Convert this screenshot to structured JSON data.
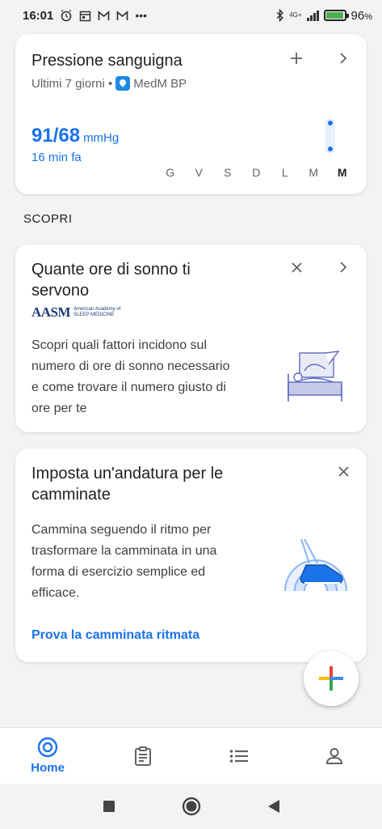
{
  "status_bar": {
    "time": "16:01",
    "left_icons": [
      "alarm-icon",
      "calendar-icon",
      "gmail-icon",
      "gmail-icon",
      "more-icon"
    ],
    "network_label": "4G+",
    "battery_text": "96",
    "battery_unit": "%",
    "battery_level": 0.96,
    "overflow_label": "•••"
  },
  "bp_card": {
    "title": "Pressione sanguigna",
    "subtitle": "Ultimi 7 giorni •",
    "source": "MedM BP",
    "value": "91/68",
    "unit": "mmHg",
    "time_ago": "16 min fa",
    "days": [
      "G",
      "V",
      "S",
      "D",
      "L",
      "M",
      "M"
    ],
    "add_icon": "plus-icon",
    "open_icon": "chevron-right-icon"
  },
  "discover": {
    "label": "SCOPRI"
  },
  "sleep_card": {
    "title_line1": "Quante ore di sonno ti",
    "title_line2": "servono",
    "publisher_mark": "AASM",
    "publisher_line1": "American Academy of",
    "publisher_line2": "SLEEP MEDICINE",
    "body_line1": "Scopri quali fattori incidono sul",
    "body_line2": "numero di ore di sonno necessario",
    "body_line3": "e come trovare il numero giusto di",
    "body_line4": "ore per te"
  },
  "walk_card": {
    "title_line1": "Imposta un'andatura per le",
    "title_line2": "camminate",
    "body_line1": "Cammina seguendo il ritmo per",
    "body_line2": "trasformare la camminata in una",
    "body_line3": "forma di esercizio semplice ed",
    "body_line4": "efficace.",
    "link": "Prova la camminata ritmata"
  },
  "bottom_nav": {
    "home_label": "Home",
    "items": [
      "home-icon",
      "journal-icon",
      "browse-icon",
      "profile-icon"
    ]
  },
  "colors": {
    "accent": "#1a73e8",
    "background": "#f1f3f4",
    "card": "#ffffff"
  }
}
